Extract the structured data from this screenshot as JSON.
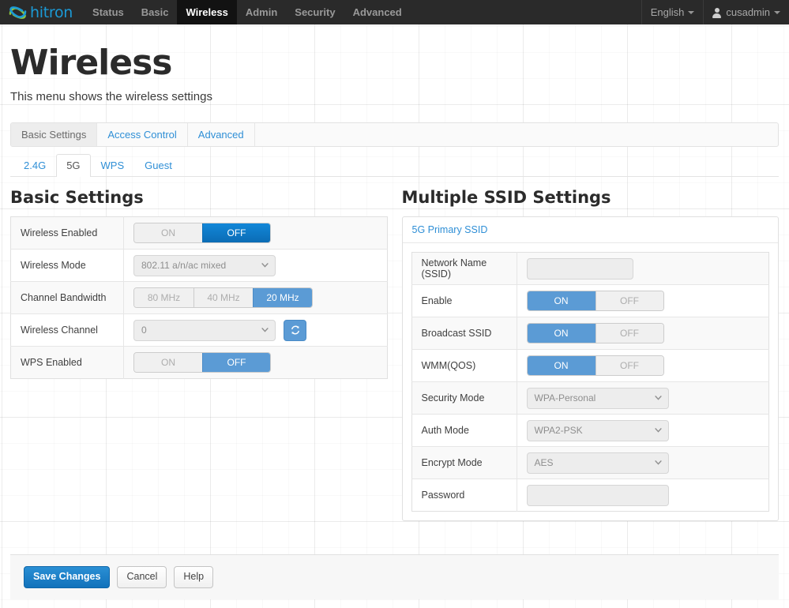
{
  "header": {
    "brand": "hitron",
    "brand_icon": "hitron-swoosh-logo",
    "nav": [
      {
        "label": "Status",
        "active": false
      },
      {
        "label": "Basic",
        "active": false
      },
      {
        "label": "Wireless",
        "active": true
      },
      {
        "label": "Admin",
        "active": false
      },
      {
        "label": "Security",
        "active": false
      },
      {
        "label": "Advanced",
        "active": false
      }
    ],
    "language": "English",
    "user": "cusadmin"
  },
  "page": {
    "title": "Wireless",
    "subtitle": "This menu shows the wireless settings"
  },
  "outer_tabs": [
    {
      "label": "Basic Settings",
      "active": true
    },
    {
      "label": "Access Control",
      "active": false
    },
    {
      "label": "Advanced",
      "active": false
    }
  ],
  "inner_tabs": [
    {
      "label": "2.4G",
      "active": false
    },
    {
      "label": "5G",
      "active": true
    },
    {
      "label": "WPS",
      "active": false
    },
    {
      "label": "Guest",
      "active": false
    }
  ],
  "basic_settings": {
    "title": "Basic Settings",
    "rows": {
      "wireless_enabled": {
        "label": "Wireless Enabled",
        "on_label": "ON",
        "off_label": "OFF",
        "value": "OFF"
      },
      "wireless_mode": {
        "label": "Wireless Mode",
        "value": "802.11 a/n/ac mixed"
      },
      "channel_bandwidth": {
        "label": "Channel Bandwidth",
        "options": [
          "80 MHz",
          "40 MHz",
          "20 MHz"
        ],
        "value": "20 MHz"
      },
      "wireless_channel": {
        "label": "Wireless Channel",
        "value": "0",
        "refresh_icon": "refresh-icon"
      },
      "wps_enabled": {
        "label": "WPS Enabled",
        "on_label": "ON",
        "off_label": "OFF",
        "value": "OFF"
      }
    }
  },
  "multiple_ssid": {
    "title": "Multiple SSID Settings",
    "panel_header": "5G Primary SSID",
    "rows": {
      "network_name": {
        "label": "Network Name (SSID)",
        "value": "",
        "placeholder": ""
      },
      "enable": {
        "label": "Enable",
        "on_label": "ON",
        "off_label": "OFF",
        "value": "ON"
      },
      "broadcast_ssid": {
        "label": "Broadcast SSID",
        "on_label": "ON",
        "off_label": "OFF",
        "value": "ON"
      },
      "wmm_qos": {
        "label": "WMM(QOS)",
        "on_label": "ON",
        "off_label": "OFF",
        "value": "ON"
      },
      "security_mode": {
        "label": "Security Mode",
        "value": "WPA-Personal"
      },
      "auth_mode": {
        "label": "Auth Mode",
        "value": "WPA2-PSK"
      },
      "encrypt_mode": {
        "label": "Encrypt Mode",
        "value": "AES"
      },
      "password": {
        "label": "Password",
        "value": "",
        "placeholder": ""
      }
    }
  },
  "footer": {
    "save_label": "Save Changes",
    "cancel_label": "Cancel",
    "help_label": "Help"
  },
  "colors": {
    "accent_blue": "#2f8fd6",
    "toggle_active_dark": "#0b6cb5",
    "toggle_active_light": "#5b9bd5",
    "nav_bg": "#2a2a2a",
    "nav_active_bg": "#121212"
  }
}
